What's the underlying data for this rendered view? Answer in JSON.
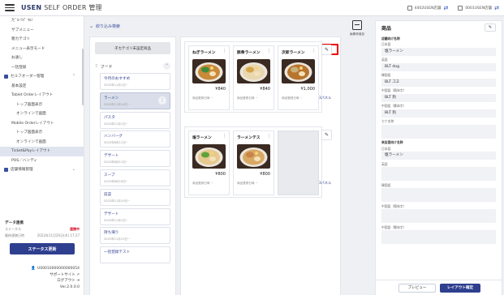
{
  "app": {
    "brand": "USEN",
    "brand_sub": "SELF ORDER 管理"
  },
  "topbar": {
    "store": "4402USEN店舗",
    "account": "0001USEN店舗"
  },
  "sidebar": {
    "items": [
      {
        "label": "ｱﾋﾟﾙｰﾂﾊﾟ ﾏﾙﾉ",
        "cls": ""
      },
      {
        "label": "サブメニュー",
        "cls": ""
      },
      {
        "label": "親カテゴリ",
        "cls": ""
      },
      {
        "label": "メニュー表示モード",
        "cls": ""
      },
      {
        "label": "お通し",
        "cls": ""
      },
      {
        "label": "一括登録",
        "cls": ""
      },
      {
        "label": "セルフオーダー管理",
        "cls": "group"
      },
      {
        "label": "基本設定",
        "cls": ""
      },
      {
        "label": "Tablet Orderレイアウト",
        "cls": ""
      },
      {
        "label": "トップ画面表示",
        "cls": "sub2"
      },
      {
        "label": "オンラインで画面",
        "cls": "sub2"
      },
      {
        "label": "Mobile Orderレイアウト",
        "cls": ""
      },
      {
        "label": "トップ画面表示",
        "cls": "sub2"
      },
      {
        "label": "オンラインで画面",
        "cls": "sub2"
      },
      {
        "label": "Ticket&Payレイアウト",
        "cls": "active"
      },
      {
        "label": "POS／ハンディ",
        "cls": ""
      },
      {
        "label": "店舗情報管理",
        "cls": "group"
      }
    ],
    "data_status": {
      "title": "データ連携",
      "status_label": "ステータス",
      "status_value": "連携中",
      "updated_label": "最終連携日時",
      "updated_value": "2022年11月20日(木) 17:27"
    },
    "status_button": "ステータス更新",
    "user_id": "U00010000000000054",
    "support": "サポートサイト",
    "logout": "ログアウト",
    "version": "Ver.2.0.0.0"
  },
  "filter": {
    "label": "絞り込み検索"
  },
  "categories": {
    "uncat_button": "子カテゴリ未設定商品",
    "food_header": "フード",
    "items": [
      {
        "name": "今月のおすすめ",
        "date": "2022年11月1日~"
      },
      {
        "name": "ラーメン",
        "date": "2022年11月14日~"
      },
      {
        "name": "パスタ",
        "date": "2022年11月1日~"
      },
      {
        "name": "ハンバーグ",
        "date": "2022年8月11日~"
      },
      {
        "name": "デザート",
        "date": "2022年8月11日~"
      },
      {
        "name": "スープ",
        "date": "2022年8月18日~"
      },
      {
        "name": "前菜",
        "date": "2022年11月10日~"
      },
      {
        "name": "デザート",
        "date": "2022年11月1日~"
      },
      {
        "name": "持ち帰り",
        "date": "2022年11月13日~"
      },
      {
        "name": "一括登録テスト",
        "date": ""
      }
    ]
  },
  "products": {
    "hidden_button": "非表示商品",
    "panel_label": "3パネル",
    "rows": [
      [
        {
          "name": "ねぎラーメン",
          "price": "¥840",
          "label": "商品登録日時 ~"
        },
        {
          "name": "豚骨ラーメン",
          "price": "¥840",
          "label": "商品登録日時 ~"
        },
        {
          "name": "次郎ラーメン",
          "price": "¥1,000",
          "label": "商品登録日時 ~"
        }
      ],
      [
        {
          "name": "塩ラーメン",
          "price": "¥800",
          "label": "商品登録日時 ~"
        },
        {
          "name": "ラーメンテス",
          "price": "¥800",
          "label": "商品登録日時 ~"
        }
      ]
    ]
  },
  "image_upload": {
    "label": "画像枠追加"
  },
  "detail": {
    "title": "商品",
    "section1": "店舗向け名称",
    "fields": [
      {
        "label": "日本語",
        "value": "塩ラーメン"
      },
      {
        "label": "英語",
        "value": "BLT dog"
      },
      {
        "label": "韓国語",
        "value": "BLT 그고"
      },
      {
        "label": "中国語（簡体字）",
        "value": "BLT 狗"
      },
      {
        "label": "中国語（繁体字）",
        "value": "BLT 狗"
      }
    ],
    "kana_label": "カナ名称",
    "section2": "来店客向け名称",
    "fields2": [
      {
        "label": "日本語",
        "value": "塩ラーメン"
      },
      {
        "label": "英語",
        "value": ""
      },
      {
        "label": "韓国語",
        "value": ""
      },
      {
        "label": "中国語（簡体字）",
        "value": ""
      },
      {
        "label": "中国語（繁体字）",
        "value": ""
      }
    ],
    "preview_button": "プレビュー",
    "confirm_button": "レイアウト確定"
  }
}
